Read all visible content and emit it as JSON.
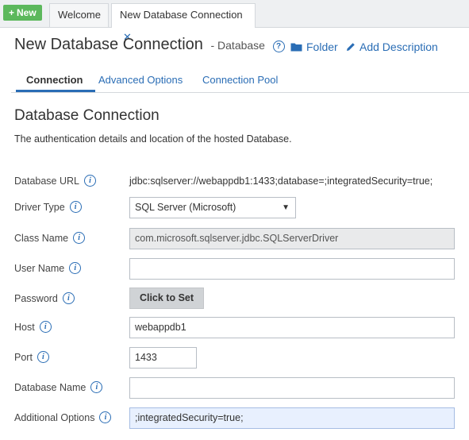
{
  "tabbar": {
    "new_label": "New",
    "tabs": [
      {
        "label": "Welcome"
      },
      {
        "label": "New Database Connection"
      }
    ]
  },
  "header": {
    "title": "New Database Connection",
    "subtitle": "- Database",
    "folder_label": "Folder",
    "add_description_label": "Add Description"
  },
  "subtabs": [
    {
      "label": "Connection"
    },
    {
      "label": "Advanced Options"
    },
    {
      "label": "Connection Pool"
    }
  ],
  "section": {
    "title": "Database Connection",
    "description": "The authentication details and location of the hosted Database."
  },
  "form": {
    "database_url": {
      "label": "Database URL",
      "value": "jdbc:sqlserver://webappdb1:1433;database=;integratedSecurity=true;"
    },
    "driver_type": {
      "label": "Driver Type",
      "value": "SQL Server (Microsoft)"
    },
    "class_name": {
      "label": "Class Name",
      "value": "com.microsoft.sqlserver.jdbc.SQLServerDriver"
    },
    "user_name": {
      "label": "User Name",
      "value": ""
    },
    "password": {
      "label": "Password",
      "button_label": "Click to Set"
    },
    "host": {
      "label": "Host",
      "value": "webappdb1"
    },
    "port": {
      "label": "Port",
      "value": "1433"
    },
    "database_name": {
      "label": "Database Name",
      "value": ""
    },
    "additional_options": {
      "label": "Additional Options",
      "value": ";integratedSecurity=true;"
    }
  },
  "colors": {
    "accent": "#2a6db5",
    "new_button": "#5cb85c",
    "highlight_field": "#e8f0fe"
  },
  "icons": {
    "help": "question-circle-icon",
    "info": "info-circle-icon",
    "folder": "folder-icon",
    "pencil": "pencil-icon",
    "close": "close-icon",
    "plus": "plus-icon",
    "caret": "caret-down-icon"
  }
}
